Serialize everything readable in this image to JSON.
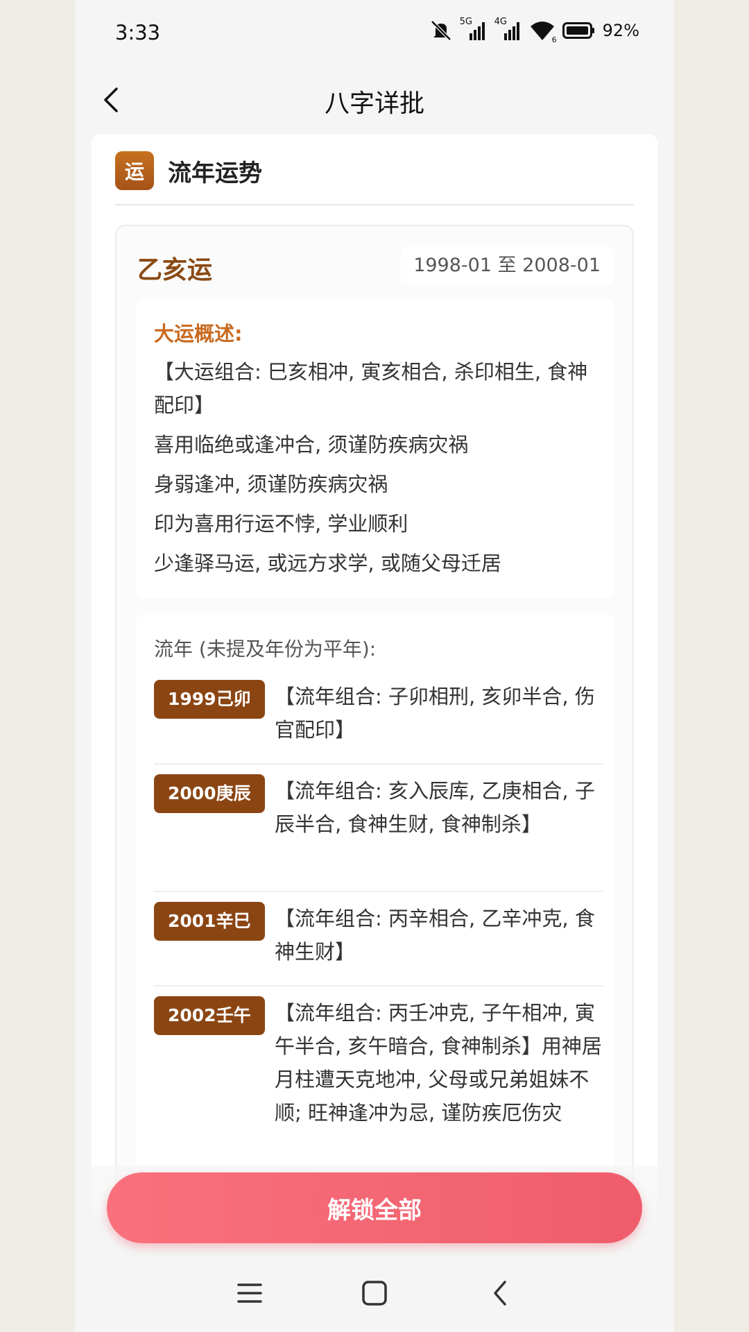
{
  "status_bar": {
    "time": "3:33",
    "network_5g": "5G",
    "network_4g": "4G",
    "wifi_label": "6",
    "battery_percent": "92%",
    "icons": [
      "mute-icon",
      "signal-5g-icon",
      "signal-4g-icon",
      "wifi-icon",
      "battery-icon"
    ]
  },
  "header": {
    "title": "八字详批",
    "back_icon": "chevron-left-icon"
  },
  "section": {
    "icon_text": "运",
    "title": "流年运势"
  },
  "dayun": {
    "name": "乙亥运",
    "range": "1998-01 至 2008-01",
    "overview_label": "大运概述:",
    "overview_lines": [
      "【大运组合: 巳亥相冲, 寅亥相合, 杀印相生, 食神配印】",
      "喜用临绝或逢冲合, 须谨防疾病灾祸",
      "身弱逢冲, 须谨防疾病灾祸",
      "印为喜用行运不悖, 学业顺利",
      "少逢驿马运, 或远方求学, 或随父母迁居"
    ]
  },
  "liunian": {
    "label": "流年 (未提及年份为平年):",
    "items": [
      {
        "badge": "1999己卯",
        "text": "【流年组合: 子卯相刑, 亥卯半合, 伤官配印】"
      },
      {
        "badge": "2000庚辰",
        "text": "【流年组合: 亥入辰库, 乙庚相合, 子辰半合, 食神生财, 食神制杀】"
      },
      {
        "badge": "2001辛巳",
        "text": "【流年组合: 丙辛相合, 乙辛冲克, 食神生财】"
      },
      {
        "badge": "2002壬午",
        "text": "【流年组合: 丙壬冲克, 子午相冲, 寅午半合, 亥午暗合, 食神制杀】用神居月柱遭天克地冲, 父母或兄弟姐妹不顺; 旺神逢冲为忌, 谨防疾厄伤灾"
      }
    ]
  },
  "unlock": {
    "label": "解锁全部"
  },
  "system_nav": {
    "icons": [
      "menu-icon",
      "home-icon",
      "back-icon"
    ]
  }
}
